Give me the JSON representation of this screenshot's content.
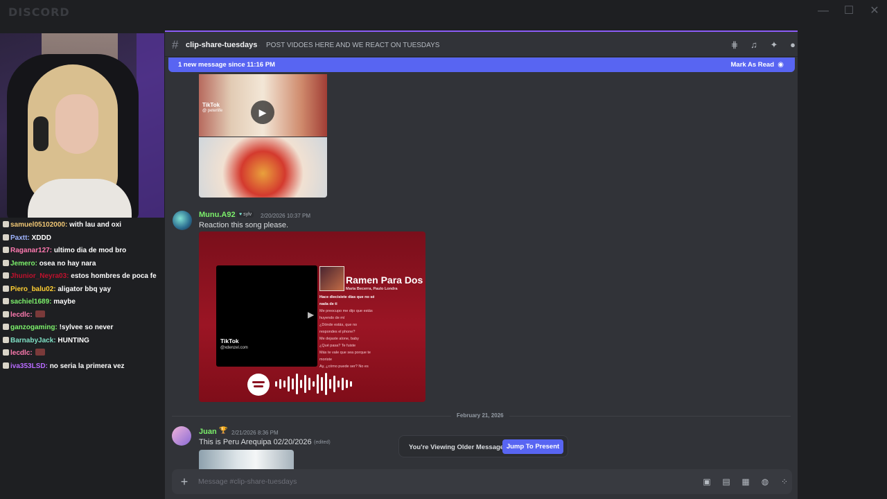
{
  "app": {
    "brand": "DISCORD"
  },
  "window_controls": {
    "minimize": "—",
    "maximize": "☐",
    "close": "✕"
  },
  "chat": {
    "lines": [
      {
        "user": "samuel05102000:",
        "user_color": "#f0c674",
        "text": "with lau and oxi"
      },
      {
        "user": "Paxtt:",
        "user_color": "#9fb4ff",
        "text": "XDDD"
      },
      {
        "user": "Raganar127:",
        "user_color": "#ff7ab0",
        "text": "ultimo dia de mod bro"
      },
      {
        "user": "Jemero:",
        "user_color": "#7cf06b",
        "text": "osea no hay nara"
      },
      {
        "user": "Jhunior_Neyra03:",
        "user_color": "#c0112d",
        "text": "estos hombres de poca fe"
      },
      {
        "user": "Piero_balu02:",
        "user_color": "#ffcf33",
        "text": "aligator bbq yay"
      },
      {
        "user": "sachiel1689:",
        "user_color": "#7cf06b",
        "text": "maybe"
      },
      {
        "user": "lecdlc:",
        "user_color": "#ff7ab0",
        "text": ""
      },
      {
        "user": "ganzogaming:",
        "user_color": "#7cf06b",
        "text": "!sylvee so never"
      },
      {
        "user": "BarnabyJack:",
        "user_color": "#7fe0c5",
        "text": "HUNTING"
      },
      {
        "user": "lecdlc:",
        "user_color": "#ff7ab0",
        "text": ""
      },
      {
        "user": "iva353LSD:",
        "user_color": "#b86bff",
        "text": "no seria la primera vez"
      }
    ]
  },
  "channel": {
    "name": "clip-share-tuesdays",
    "topic": "POST VIDOES HERE AND WE REACT ON TUESDAYS"
  },
  "new_bar": {
    "text": "1 new message since 11:16 PM",
    "mark_label": "Mark As Read"
  },
  "tiktok_embed": {
    "label": "TikTok",
    "user": "@ peterlife"
  },
  "messages": [
    {
      "author": "Munu.A92",
      "author_color": "#7cf06b",
      "tag": "sylv",
      "time": "2/20/2026 10:37 PM",
      "text": "Reaction this song please.",
      "embed": {
        "tiktok_label": "TikTok",
        "tiktok_user": "@xdenzel.com",
        "song_title": "Ramen Para Dos",
        "song_artist": "Maria Becerra, Paulo Londra",
        "lyrics": [
          "Hace diecisiete días que no sé",
          "nada de ti",
          "Me preocupo me dijo que estás",
          "huyendo de mí",
          "¿Dónde estás, que no",
          "respondes el phone?",
          "Me dejaste alone, baby",
          "¿Qué pasa? Te fuiste",
          "Más te vale que sea porque te",
          "moriste",
          "Ay, ¿cómo puede ser? No es"
        ]
      }
    },
    {
      "author": "Juan",
      "author_color": "#7cf06b",
      "time": "2/21/2026 8:36 PM",
      "text": "This is Peru  Arequipa 02/20/2026",
      "edited": "(edited)"
    }
  ],
  "date_divider": "February 21, 2026",
  "older_notice": {
    "label": "You're Viewing Older Messages",
    "button": "Jump To Present"
  },
  "composer": {
    "placeholder": "Message #clip-share-tuesdays"
  }
}
